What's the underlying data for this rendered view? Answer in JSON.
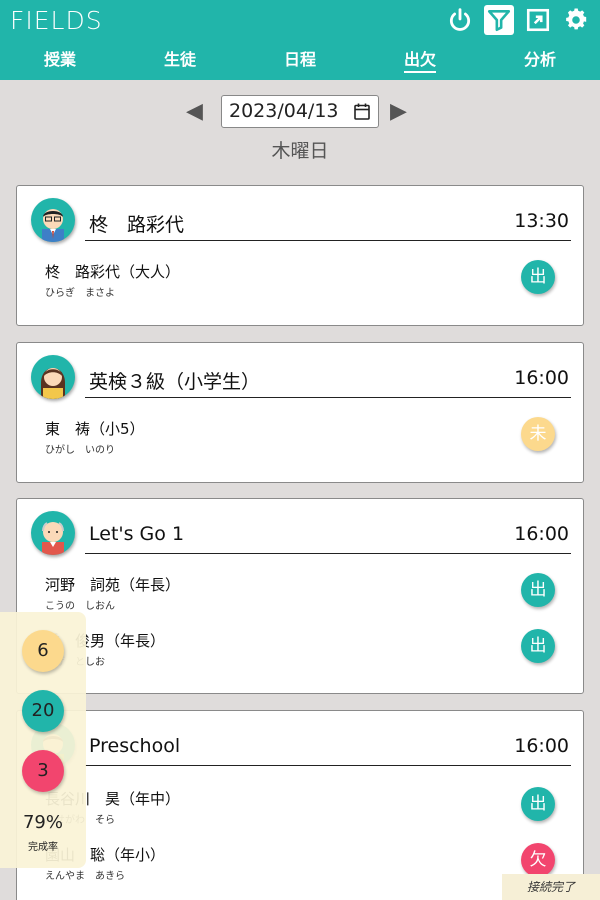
{
  "app": {
    "title": "FIELDS"
  },
  "header_icons": [
    "power-icon",
    "filter-icon",
    "expand-icon",
    "gear-icon"
  ],
  "nav": [
    {
      "label": "授業",
      "active": false
    },
    {
      "label": "生徒",
      "active": false
    },
    {
      "label": "日程",
      "active": false
    },
    {
      "label": "出欠",
      "active": true
    },
    {
      "label": "分析",
      "active": false
    }
  ],
  "date": {
    "value": "2023/04/13",
    "weekday": "木曜日"
  },
  "colors": {
    "primary": "#21b5aa",
    "present": "#21b5aa",
    "pending": "#fcd98d",
    "absent": "#f2456e"
  },
  "classes": [
    {
      "title": "柊　路彩代",
      "time": "13:30",
      "students": [
        {
          "name": "柊　路彩代（大人）",
          "kana": "ひらぎ　まさよ",
          "status": "出",
          "status_type": "present"
        }
      ]
    },
    {
      "title": "英検３級（小学生）",
      "time": "16:00",
      "students": [
        {
          "name": "東　祷（小5）",
          "kana": "ひがし　いのり",
          "status": "未",
          "status_type": "pending"
        }
      ]
    },
    {
      "title": "Let's Go 1",
      "time": "16:00",
      "students": [
        {
          "name": "河野　詞苑（年長）",
          "kana": "こうの　しおん",
          "status": "出",
          "status_type": "present"
        },
        {
          "name": "重　俊男（年長）",
          "kana": "しげ　としお",
          "status": "出",
          "status_type": "present"
        }
      ]
    },
    {
      "title": "Preschool",
      "time": "16:00",
      "students": [
        {
          "name": "長谷川　昊（年中）",
          "kana": "はせがわ　そら",
          "status": "出",
          "status_type": "present"
        },
        {
          "name": "園山　聡（年小）",
          "kana": "えんやま　あきら",
          "status": "欠",
          "status_type": "absent"
        }
      ]
    }
  ],
  "stats": {
    "pending": "6",
    "present": "20",
    "absent": "3",
    "rate": "79%",
    "rate_label": "完成率"
  },
  "connection_status": "接続完了"
}
